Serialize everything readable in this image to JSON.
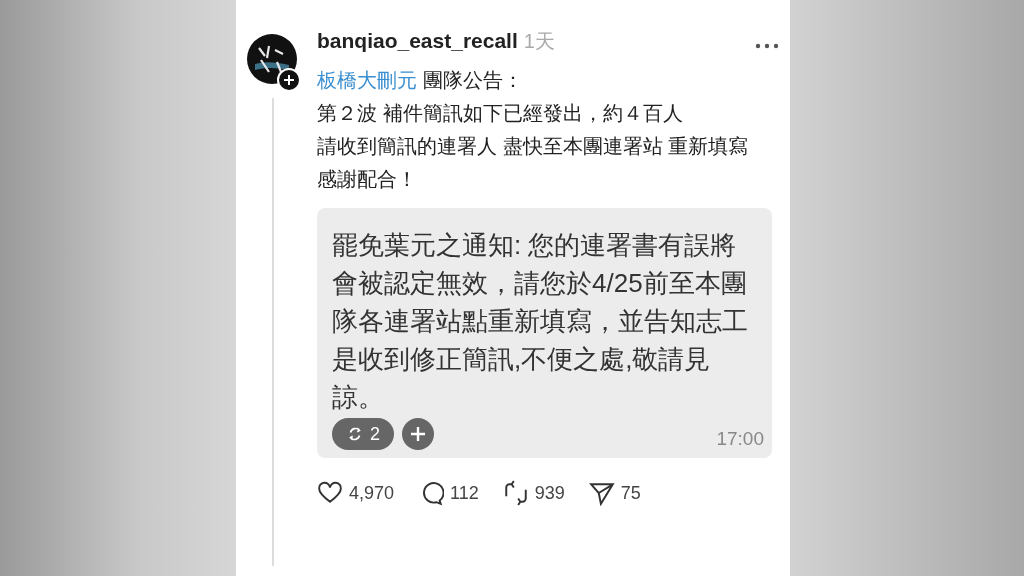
{
  "post": {
    "username": "banqiao_east_recall",
    "time": "1天",
    "mention": "板橋大刪元",
    "first_line": "團隊公告：",
    "lines": [
      "第２波 補件簡訊如下已經發出，約４百人",
      "請收到簡訊的連署人 盡快至本團連署站 重新填寫",
      "感謝配合！"
    ],
    "attachment": {
      "message": "罷免葉元之通知: 您的連署書有誤將會被認定無效，請您於4/25前至本團隊各連署站點重新填寫，並告知志工是收到修正簡訊,不便之處,敬請見諒。",
      "repost_count": "2",
      "time": "17:00"
    },
    "actions": [
      {
        "kind": "like",
        "count": "4,970"
      },
      {
        "kind": "comment",
        "count": "112"
      },
      {
        "kind": "repost",
        "count": "939"
      },
      {
        "kind": "share",
        "count": "75"
      }
    ]
  }
}
